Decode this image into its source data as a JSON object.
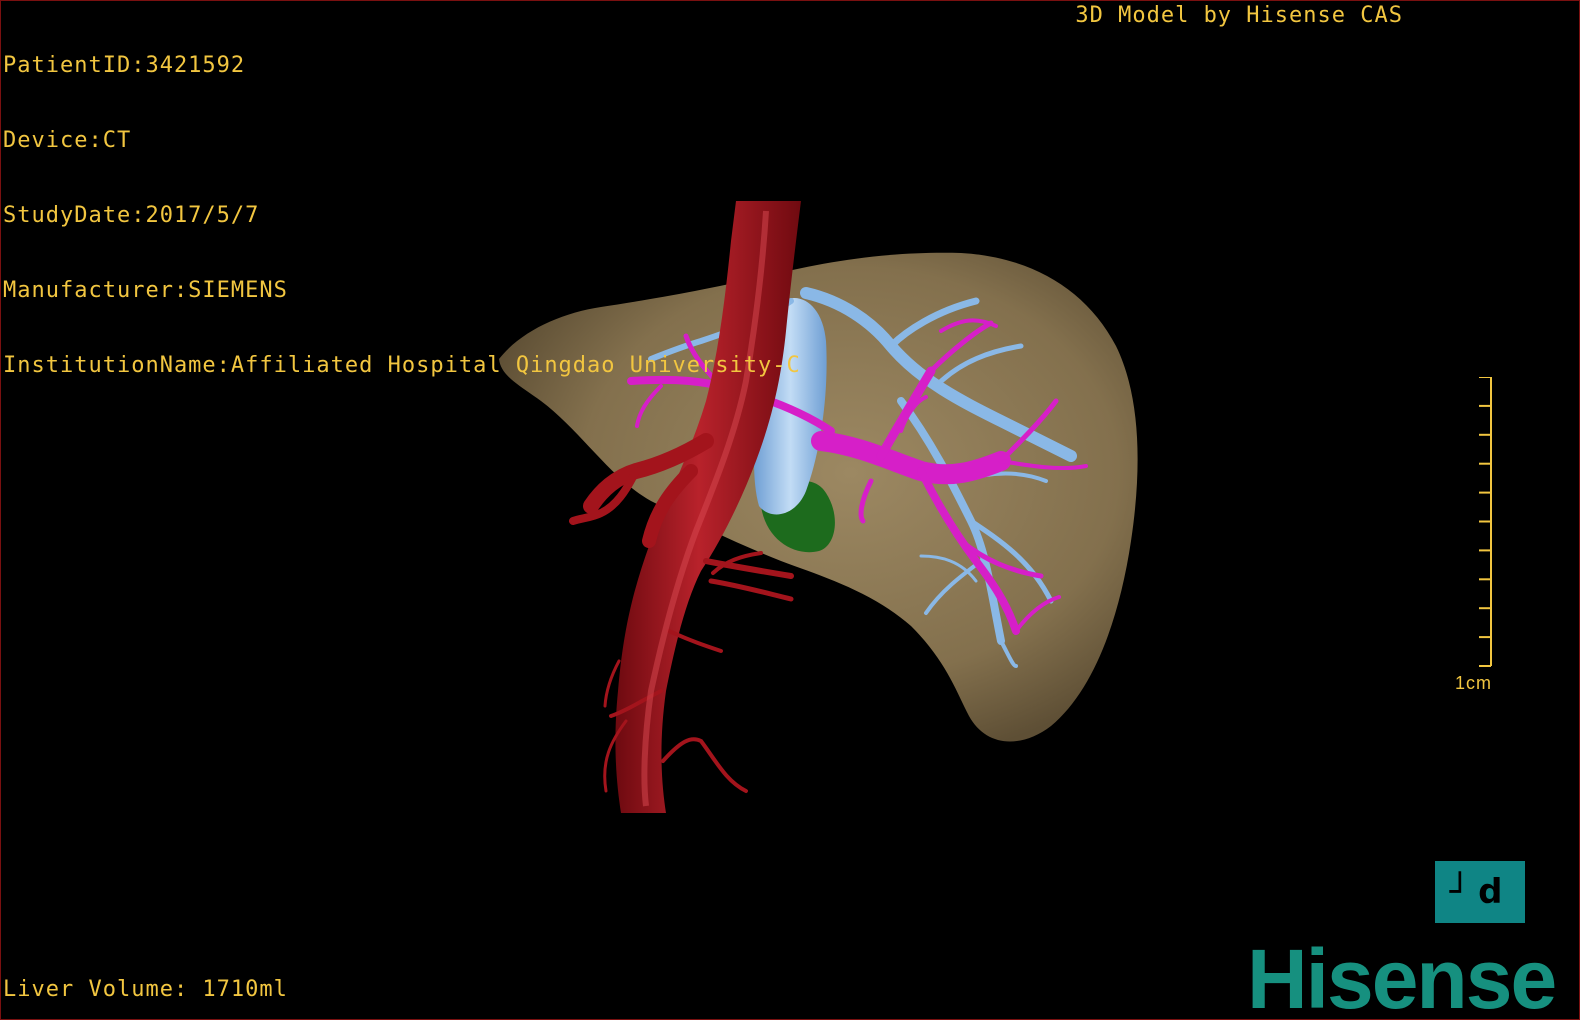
{
  "dicom_info": {
    "patient_id": "PatientID:3421592",
    "device": "Device:CT",
    "study_date": "StudyDate:2017/5/7",
    "manufacturer": "Manufacturer:SIEMENS",
    "institution": "InstitutionName:Affiliated Hospital Qingdao University-C"
  },
  "model_credit": "3D Model by Hisense CAS",
  "liver_volume": "Liver Volume: 1710ml",
  "scale": {
    "label": "1cm",
    "ticks": 10
  },
  "orientation_button": {
    "label": "┘d",
    "icon": "view-orientation-icon"
  },
  "brand": "Hisense",
  "colors": {
    "overlay_text": "#f2c640",
    "liver": "#8a7654",
    "artery": "#a3141c",
    "portal_vein": "#d61fc8",
    "hepatic_vein": "#8ab8e6",
    "vena_cava": "#a9cdf0",
    "gallbladder": "#1d6b1d",
    "brand": "#16907f",
    "button_bg": "#0f8585"
  }
}
